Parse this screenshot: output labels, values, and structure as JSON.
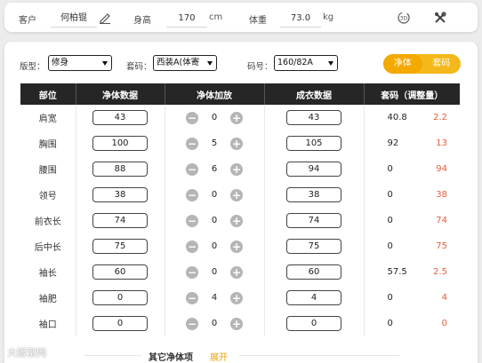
{
  "customer": {
    "customer_label": "客户",
    "customer_name": "何柏锟",
    "height_label": "身高",
    "height_value": "170",
    "height_unit": "cm",
    "weight_label": "体重",
    "weight_value": "73.0",
    "weight_unit": "kg",
    "icons": [
      "edit-icon",
      "rotate-3d-icon",
      "tools-icon"
    ]
  },
  "filters": {
    "fit_label": "版型：",
    "fit_value": "修身",
    "size_code_label": "套码：",
    "size_code_value": "西装A(体寄",
    "size_label": "码号：",
    "size_value": "160/82A"
  },
  "toggle": {
    "left": "净体",
    "right": "套码"
  },
  "table": {
    "headers": [
      "部位",
      "净体数据",
      "净体加放",
      "成衣数据",
      "套码（调整量）"
    ],
    "rows": [
      {
        "part": "肩宽",
        "net": "43",
        "allow": "0",
        "garment": "43",
        "size": "40.8",
        "adj": "2.2"
      },
      {
        "part": "胸围",
        "net": "100",
        "allow": "5",
        "garment": "105",
        "size": "92",
        "adj": "13"
      },
      {
        "part": "腰围",
        "net": "88",
        "allow": "6",
        "garment": "94",
        "size": "0",
        "adj": "94"
      },
      {
        "part": "领号",
        "net": "38",
        "allow": "0",
        "garment": "38",
        "size": "0",
        "adj": "38"
      },
      {
        "part": "前衣长",
        "net": "74",
        "allow": "0",
        "garment": "74",
        "size": "0",
        "adj": "74"
      },
      {
        "part": "后中长",
        "net": "75",
        "allow": "0",
        "garment": "75",
        "size": "0",
        "adj": "75"
      },
      {
        "part": "袖长",
        "net": "60",
        "allow": "0",
        "garment": "60",
        "size": "57.5",
        "adj": "2.5"
      },
      {
        "part": "袖肥",
        "net": "0",
        "allow": "4",
        "garment": "4",
        "size": "0",
        "adj": "4"
      },
      {
        "part": "袖口",
        "net": "0",
        "allow": "0",
        "garment": "0",
        "size": "0",
        "adj": "0"
      }
    ],
    "stepper_minus": "−",
    "stepper_plus": "+"
  },
  "more": {
    "title": "其它净体项",
    "link": "展开"
  },
  "watermark": "大版型网",
  "colors": {
    "accent": "#f3a900",
    "header_bg": "#262626",
    "adjust_text": "#e85b3a"
  }
}
